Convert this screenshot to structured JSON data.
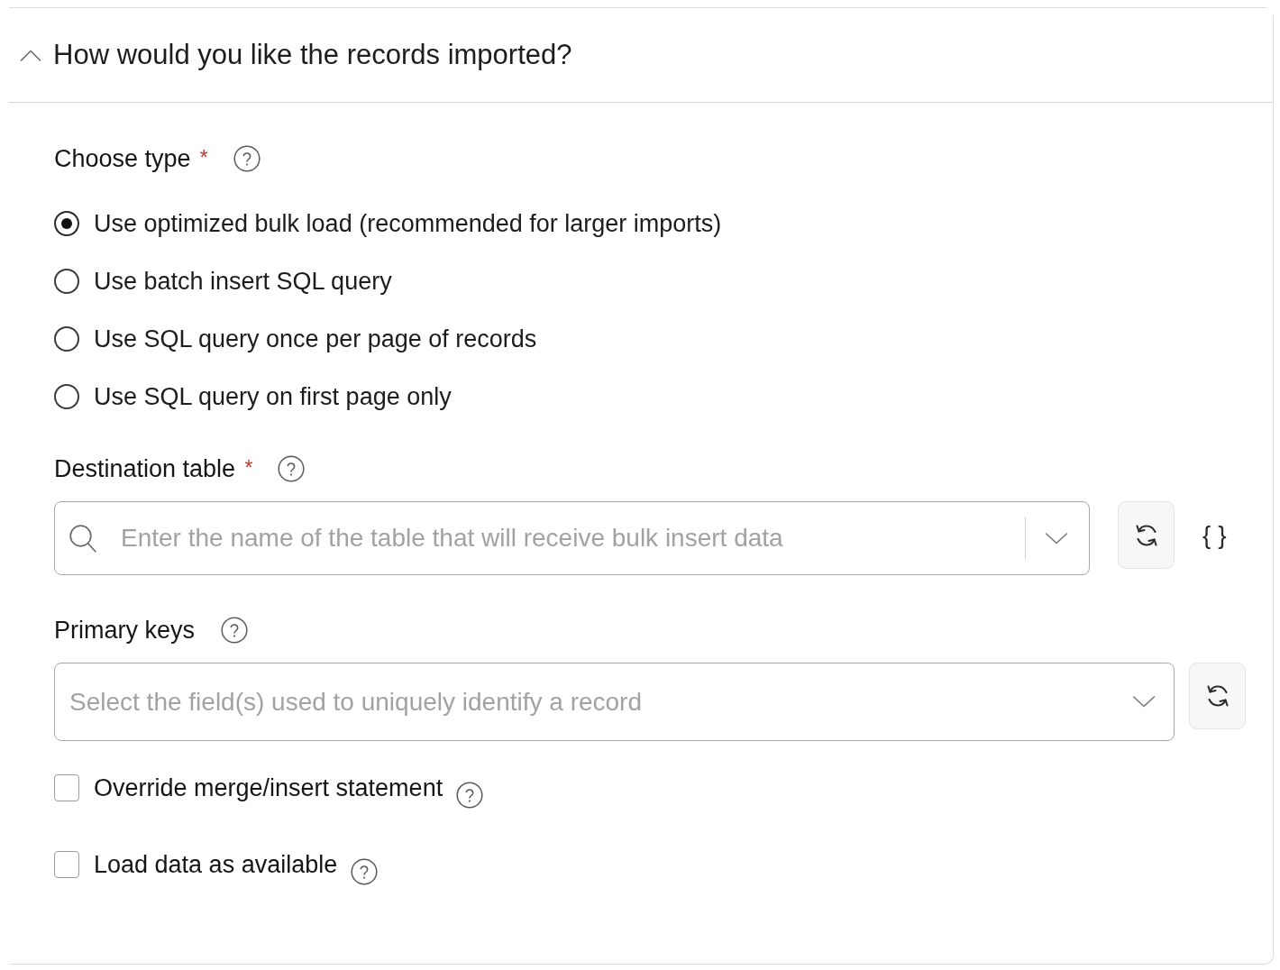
{
  "section": {
    "title": "How would you like the records imported?",
    "expanded": true
  },
  "fields": [
    {
      "kind": "radio_group",
      "label": "Choose type",
      "required_mark": "*",
      "options": [
        {
          "label": "Use optimized bulk load (recommended for larger imports)",
          "selected": true
        },
        {
          "label": "Use batch insert SQL query",
          "selected": false
        },
        {
          "label": "Use SQL query once per page of records",
          "selected": false
        },
        {
          "label": "Use SQL query on first page only",
          "selected": false
        }
      ]
    },
    {
      "kind": "select",
      "label": "Destination table",
      "required_mark": "*",
      "placeholder": "Enter the name of the table that will receive bulk insert data",
      "search_icon": true,
      "actions": [
        {
          "kind": "refresh"
        },
        {
          "kind": "expression",
          "text": "{ }"
        }
      ]
    },
    {
      "kind": "select",
      "label": "Primary keys",
      "placeholder": "Select the field(s) used to uniquely identify a record",
      "search_icon": false,
      "actions": [
        {
          "kind": "refresh"
        }
      ]
    },
    {
      "kind": "checkbox",
      "label": "Override merge/insert statement",
      "checked": false
    },
    {
      "kind": "checkbox",
      "label": "Load data as available",
      "checked": false
    }
  ]
}
